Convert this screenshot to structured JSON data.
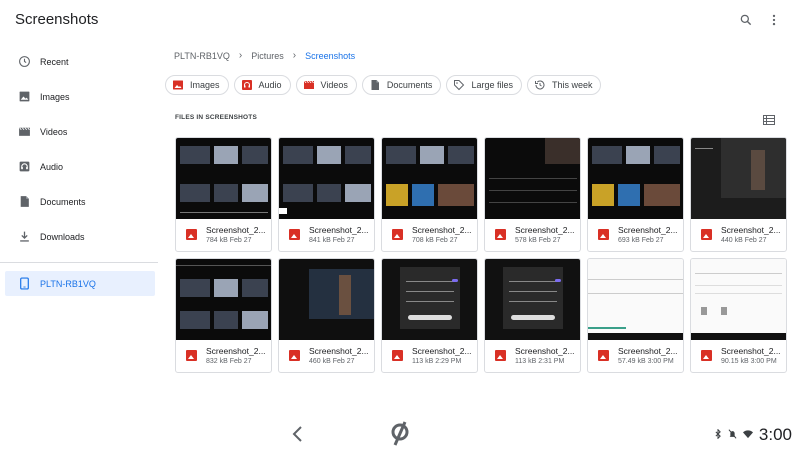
{
  "app": {
    "title": "Screenshots"
  },
  "header": {
    "search_icon": "search-icon",
    "more_icon": "more-vert-icon"
  },
  "sidebar": {
    "items": [
      {
        "label": "Recent",
        "icon": "clock-icon"
      },
      {
        "label": "Images",
        "icon": "image-icon"
      },
      {
        "label": "Videos",
        "icon": "movie-icon"
      },
      {
        "label": "Audio",
        "icon": "headphones-icon"
      },
      {
        "label": "Documents",
        "icon": "document-icon"
      },
      {
        "label": "Downloads",
        "icon": "download-icon"
      }
    ],
    "device": {
      "label": "PLTN-RB1VQ",
      "icon": "tablet-icon"
    }
  },
  "breadcrumb": [
    "PLTN-RB1VQ",
    "Pictures",
    "Screenshots"
  ],
  "chips": [
    {
      "label": "Images",
      "icon": "image-icon",
      "color": "#d93025"
    },
    {
      "label": "Audio",
      "icon": "headphones-icon",
      "color": "#d93025"
    },
    {
      "label": "Videos",
      "icon": "movie-icon",
      "color": "#d93025"
    },
    {
      "label": "Documents",
      "icon": "document-icon",
      "color": "#5f6368"
    },
    {
      "label": "Large files",
      "icon": "tag-icon",
      "color": "#5f6368"
    },
    {
      "label": "This week",
      "icon": "history-icon",
      "color": "#5f6368"
    }
  ],
  "section": {
    "label": "FILES IN SCREENSHOTS"
  },
  "files": [
    {
      "name": "Screenshot_2...",
      "meta": "784 kB Feb 27"
    },
    {
      "name": "Screenshot_2...",
      "meta": "841 kB Feb 27"
    },
    {
      "name": "Screenshot_2...",
      "meta": "708 kB Feb 27"
    },
    {
      "name": "Screenshot_2...",
      "meta": "578 kB Feb 27"
    },
    {
      "name": "Screenshot_2...",
      "meta": "693 kB Feb 27"
    },
    {
      "name": "Screenshot_2...",
      "meta": "440 kB Feb 27"
    },
    {
      "name": "Screenshot_2...",
      "meta": "832 kB Feb 27"
    },
    {
      "name": "Screenshot_2...",
      "meta": "460 kB Feb 27"
    },
    {
      "name": "Screenshot_2...",
      "meta": "113 kB 2:29 PM"
    },
    {
      "name": "Screenshot_2...",
      "meta": "113 kB 2:31 PM"
    },
    {
      "name": "Screenshot_2...",
      "meta": "57.49 kB 3:00 PM"
    },
    {
      "name": "Screenshot_2...",
      "meta": "90.15 kB 3:00 PM"
    }
  ],
  "status_bar": {
    "time": "3:00"
  },
  "colors": {
    "accent": "#1a73e8",
    "image_red": "#d93025",
    "active_bg": "#e8f0fe"
  }
}
